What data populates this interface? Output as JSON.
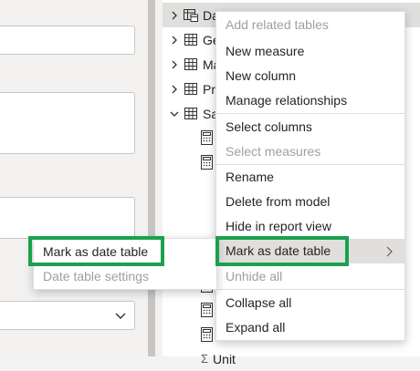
{
  "fields_pane": {
    "tables": [
      {
        "label": "Da",
        "expanded": false,
        "icon": "date-table-icon"
      },
      {
        "label": "Ge",
        "expanded": false,
        "icon": "table-icon"
      },
      {
        "label": "Ma",
        "expanded": false,
        "icon": "table-icon"
      },
      {
        "label": "Pr",
        "expanded": false,
        "icon": "table-icon"
      },
      {
        "label": "Sa",
        "expanded": true,
        "icon": "table-icon"
      }
    ],
    "partial_bottom_label": "Unit"
  },
  "context_menu": {
    "items": [
      {
        "label": "Add related tables",
        "disabled": true
      },
      {
        "label": "New measure",
        "disabled": false
      },
      {
        "label": "New column",
        "disabled": false
      },
      {
        "label": "Manage relationships",
        "disabled": false
      },
      {
        "label": "Select columns",
        "disabled": false
      },
      {
        "label": "Select measures",
        "disabled": true
      },
      {
        "label": "Rename",
        "disabled": false
      },
      {
        "label": "Delete from model",
        "disabled": false
      },
      {
        "label": "Hide in report view",
        "disabled": false
      },
      {
        "label": "Mark as date table",
        "disabled": false,
        "has_submenu": true,
        "active": true
      },
      {
        "label": "Unhide all",
        "disabled": true
      },
      {
        "label": "Collapse all",
        "disabled": false
      },
      {
        "label": "Expand all",
        "disabled": false
      }
    ]
  },
  "submenu": {
    "items": [
      {
        "label": "Mark as date table",
        "disabled": false
      },
      {
        "label": "Date table settings",
        "disabled": true
      }
    ]
  },
  "colors": {
    "highlight_box": "#1aa14f",
    "disabled_text": "#a19f9d",
    "active_item_bg": "#e1dfdd"
  }
}
